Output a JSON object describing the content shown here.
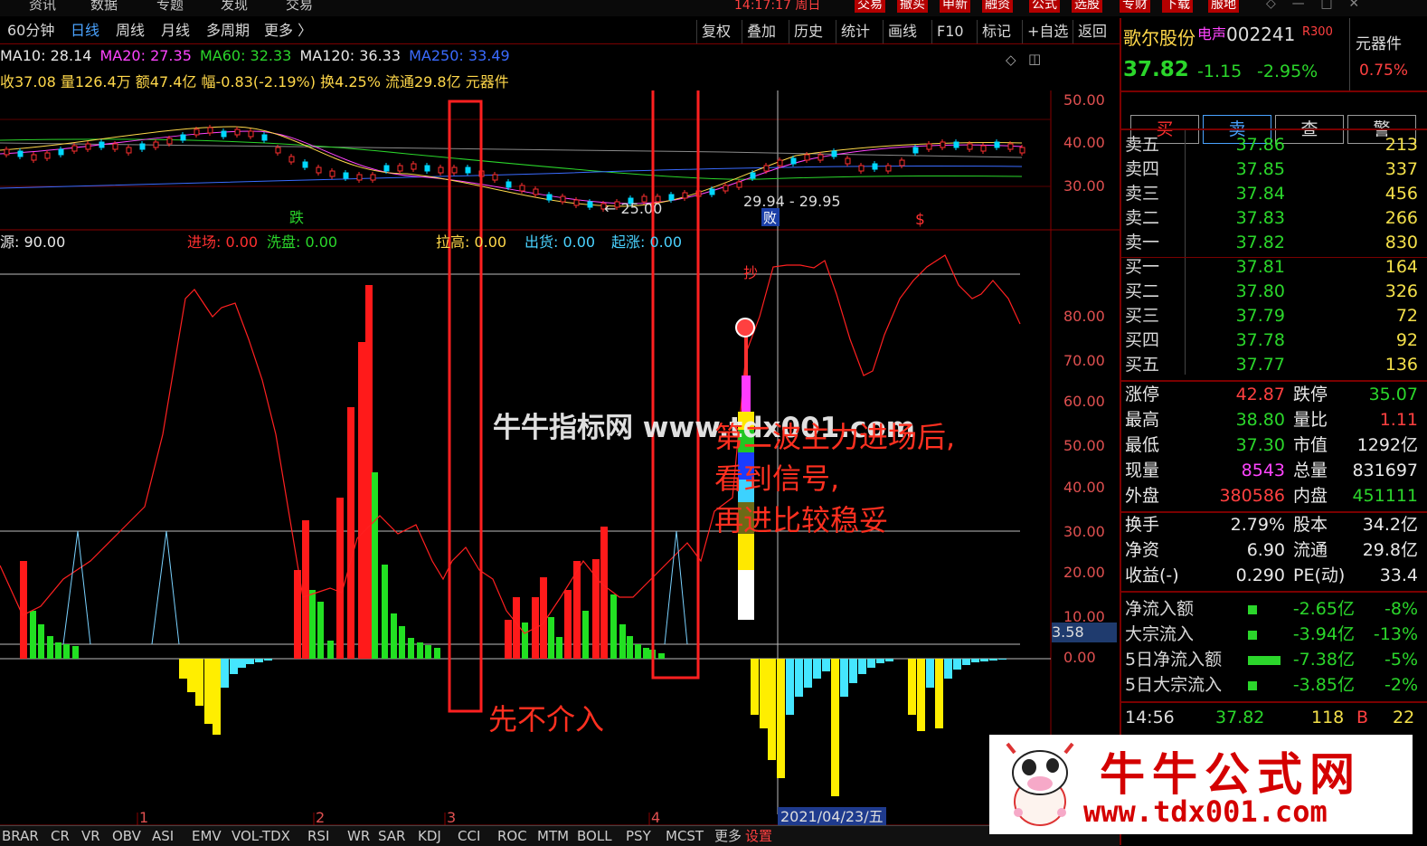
{
  "top_menu": [
    "资讯",
    "数据",
    "专题",
    "发现",
    "交易"
  ],
  "top_time": "14:17:17 周日",
  "top_buttons": [
    "交易",
    "撤买",
    "申新",
    "融资",
    "公式",
    "选股",
    "专财",
    "下载",
    "服地"
  ],
  "toolbar": {
    "periods": [
      "60分钟",
      "日线",
      "周线",
      "月线",
      "多周期",
      "更多 〉"
    ],
    "active_period": "日线",
    "right_buttons": [
      "复权",
      "叠加",
      "历史",
      "统计",
      "画线",
      "F10",
      "标记",
      "+自选",
      "返回"
    ]
  },
  "ma_line": {
    "ma10": "MA10: 28.14",
    "ma20": "MA20: 27.35",
    "ma60": "MA60: 32.33",
    "ma120": "MA120: 36.33",
    "ma250": "MA250: 33.49"
  },
  "info_line": "收37.08 量126.4万 额47.4亿 幅-0.83(-2.19%) 换4.25% 流通29.8亿 元器件",
  "price_axis": [
    "50.00",
    "40.00",
    "30.00"
  ],
  "price_marks": {
    "low": "← 25.00",
    "range": "29.94 - 29.95",
    "fall_tag": "跌",
    "buy_tag": "败",
    "s_tag": "$"
  },
  "indicator_header": {
    "first": "源: 90.00",
    "items": [
      {
        "label": "进场: 0.00",
        "color": "#ff3030"
      },
      {
        "label": "洗盘: 0.00",
        "color": "#2bd62b"
      },
      {
        "label": "拉高: 0.00",
        "color": "#ffd84a"
      },
      {
        "label": "出货: 0.00",
        "color": "#4ad2ff"
      },
      {
        "label": "起涨: 0.00",
        "color": "#4ad2ff"
      }
    ]
  },
  "ind_axis": [
    "80.00",
    "70.00",
    "60.00",
    "50.00",
    "40.00",
    "30.00",
    "20.00",
    "10.00",
    "0.00"
  ],
  "ind_value_tag": "3.58",
  "chao_tag": "抄",
  "annotations": {
    "left_box": "先不介入",
    "right_lines": [
      "第二波主力进场后,",
      "看到信号,",
      "再进比较稳妥"
    ]
  },
  "watermark_mid": "牛牛指标网 www.tdx001.com",
  "watermark_logo": {
    "title": "牛牛公式网",
    "url": "www.tdx001.com"
  },
  "x_axis": [
    "1",
    "2",
    "3",
    "4"
  ],
  "date_tag": "2021/04/23/五",
  "bottom_tabs": [
    "BRAR",
    "CR",
    "VR",
    "OBV",
    "ASI",
    "EMV",
    "VOL-TDX",
    "RSI",
    "WR",
    "SAR",
    "KDJ",
    "CCI",
    "ROC",
    "MTM",
    "BOLL",
    "PSY",
    "MCST",
    "更多",
    "设置"
  ],
  "stock": {
    "name": "歌尔股份",
    "tag": "电声",
    "code": "002241",
    "r": "R300",
    "sector": "元器件",
    "price": "37.82",
    "change": "-1.15",
    "pct": "-2.95%",
    "sector_pct": "0.75%"
  },
  "trade_buttons": [
    "买",
    "卖",
    "查",
    "警"
  ],
  "asks": [
    {
      "label": "卖五",
      "price": "37.86",
      "vol": "213"
    },
    {
      "label": "卖四",
      "price": "37.85",
      "vol": "337"
    },
    {
      "label": "卖三",
      "price": "37.84",
      "vol": "456"
    },
    {
      "label": "卖二",
      "price": "37.83",
      "vol": "266"
    },
    {
      "label": "卖一",
      "price": "37.82",
      "vol": "830"
    }
  ],
  "bids": [
    {
      "label": "买一",
      "price": "37.81",
      "vol": "164"
    },
    {
      "label": "买二",
      "price": "37.80",
      "vol": "326"
    },
    {
      "label": "买三",
      "price": "37.79",
      "vol": "72"
    },
    {
      "label": "买四",
      "price": "37.78",
      "vol": "92"
    },
    {
      "label": "买五",
      "price": "37.77",
      "vol": "136"
    }
  ],
  "stats": [
    {
      "l1": "涨停",
      "v1": "42.87",
      "c1": "red",
      "l2": "跌停",
      "v2": "35.07",
      "c2": "green"
    },
    {
      "l1": "最高",
      "v1": "38.80",
      "c1": "green",
      "l2": "量比",
      "v2": "1.11",
      "c2": "red"
    },
    {
      "l1": "最低",
      "v1": "37.30",
      "c1": "green",
      "l2": "市值",
      "v2": "1292亿",
      "c2": "white"
    },
    {
      "l1": "现量",
      "v1": "8543",
      "c1": "magenta",
      "l2": "总量",
      "v2": "831697",
      "c2": "white"
    },
    {
      "l1": "外盘",
      "v1": "380586",
      "c1": "red",
      "l2": "内盘",
      "v2": "451111",
      "c2": "green"
    }
  ],
  "fund": [
    {
      "l1": "换手",
      "v1": "2.79%",
      "l2": "股本",
      "v2": "34.2亿"
    },
    {
      "l1": "净资",
      "v1": "6.90",
      "l2": "流通",
      "v2": "29.8亿"
    },
    {
      "l1": "收益(-)",
      "v1": "0.290",
      "l2": "PE(动)",
      "v2": "33.4"
    }
  ],
  "flows": [
    {
      "label": "净流入额",
      "value": "-2.65亿",
      "pct": "-8%",
      "bar": 0.08
    },
    {
      "label": "大宗流入",
      "value": "-3.94亿",
      "pct": "-13%",
      "bar": 0.08
    },
    {
      "label": "5日净流入额",
      "value": "-7.38亿",
      "pct": "-5%",
      "bar": 0.3
    },
    {
      "label": "5日大宗流入",
      "value": "-3.85亿",
      "pct": "-2%",
      "bar": 0.08
    }
  ],
  "tick": {
    "time": "14:56",
    "price": "37.82",
    "vol": "118",
    "side": "B",
    "extra": "22"
  }
}
